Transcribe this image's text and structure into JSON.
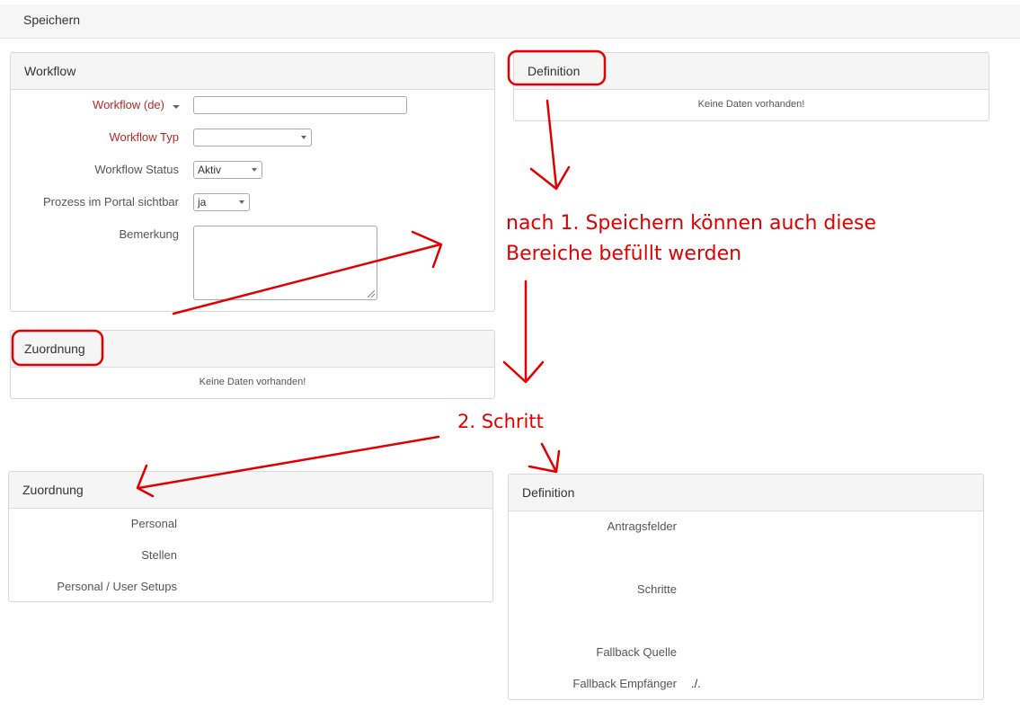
{
  "toolbar": {
    "save_label": "Speichern"
  },
  "workflow_panel": {
    "title": "Workflow",
    "fields": {
      "name_label": "Workflow (de)",
      "name_value": "",
      "type_label": "Workflow Typ",
      "type_value": "",
      "status_label": "Workflow Status",
      "status_value": "Aktiv",
      "portal_label": "Prozess im Portal sichtbar",
      "portal_value": "ja",
      "remark_label": "Bemerkung",
      "remark_value": ""
    }
  },
  "definition_top": {
    "title": "Definition",
    "empty": "Keine Daten vorhanden!"
  },
  "zuordnung_top": {
    "title": "Zuordnung",
    "empty": "Keine Daten vorhanden!"
  },
  "zuordnung_bottom": {
    "title": "Zuordnung",
    "rows": [
      "Personal",
      "Stellen",
      "Personal / User Setups"
    ]
  },
  "definition_bottom": {
    "title": "Definition",
    "rows": [
      {
        "label": "Antragsfelder",
        "value": ""
      },
      {
        "label": "Schritte",
        "value": ""
      },
      {
        "label": "Fallback Quelle",
        "value": ""
      },
      {
        "label": "Fallback Empfänger",
        "value": "./."
      }
    ]
  },
  "annotations": {
    "note_line1": "nach 1. Speichern können auch diese",
    "note_line2": "Bereiche befüllt werden",
    "step2": "2. Schritt",
    "color": "#e00000"
  }
}
